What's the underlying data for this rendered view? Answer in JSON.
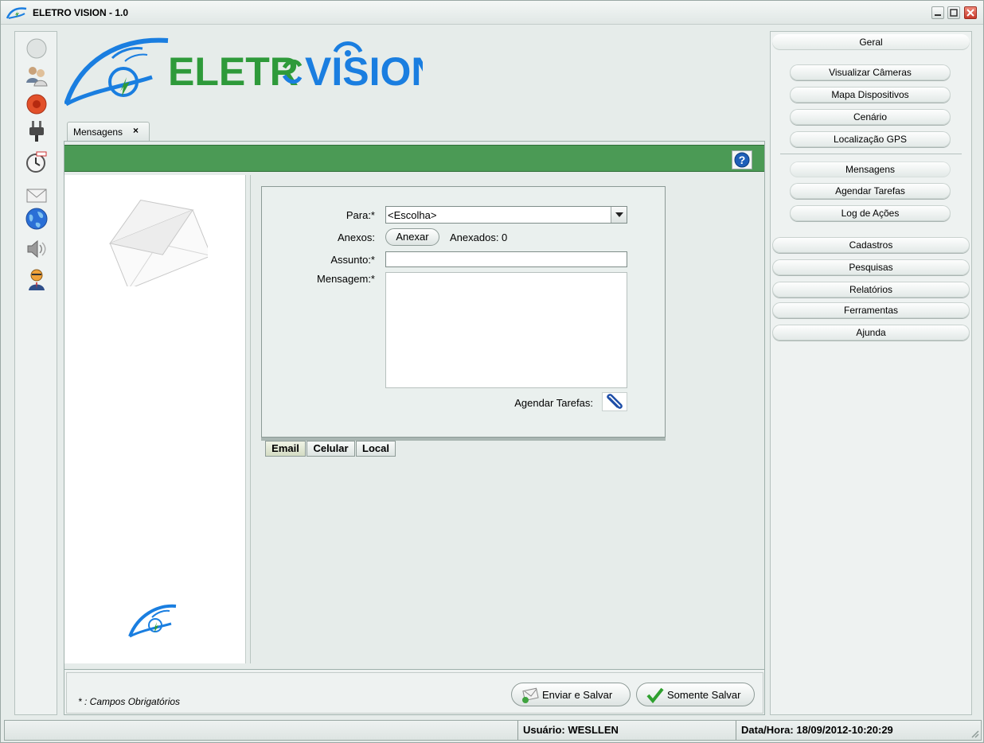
{
  "window": {
    "title": "ELETRO VISION - 1.0"
  },
  "logo": {
    "brand_left": "ELETR",
    "brand_right": "VISION"
  },
  "left_toolbar": {
    "icons": [
      "status-circle-icon",
      "users-icon",
      "record-icon",
      "plug-icon",
      "alarm-clock-icon",
      "mail-icon",
      "globe-icon",
      "speaker-icon",
      "user-agent-icon"
    ]
  },
  "tabs": [
    {
      "label": "Mensagens",
      "close": "×"
    }
  ],
  "form": {
    "para_label": "Para:*",
    "para_value": "<Escolha>",
    "anexos_label": "Anexos:",
    "anexar_button": "Anexar",
    "anexados_text": "Anexados: 0",
    "assunto_label": "Assunto:*",
    "assunto_value": "",
    "mensagem_label": "Mensagem:*",
    "mensagem_value": "",
    "agendar_label": "Agendar Tarefas:"
  },
  "subtabs": [
    {
      "label": "Email",
      "active": true
    },
    {
      "label": "Celular",
      "active": false
    },
    {
      "label": "Local",
      "active": false
    }
  ],
  "footer": {
    "required_note": "* : Campos Obrigatórios",
    "send_save_button": "Enviar e Salvar",
    "save_only_button": "Somente Salvar"
  },
  "right_panel": {
    "header": "Geral",
    "group1": [
      "Visualizar Câmeras",
      "Mapa Dispositivos",
      "Cenário",
      "Localização GPS"
    ],
    "group2": [
      "Mensagens",
      "Agendar Tarefas",
      "Log de Ações"
    ],
    "group3": [
      "Cadastros",
      "Pesquisas",
      "Relatórios",
      "Ferramentas",
      "Ajunda"
    ]
  },
  "status": {
    "user": "Usuário: WESLLEN",
    "datetime": "Data/Hora: 18/09/2012-10:20:29"
  },
  "colors": {
    "brand_green": "#2e9a3a",
    "brand_blue": "#1a7ee0",
    "header_green": "#4b9a55"
  }
}
